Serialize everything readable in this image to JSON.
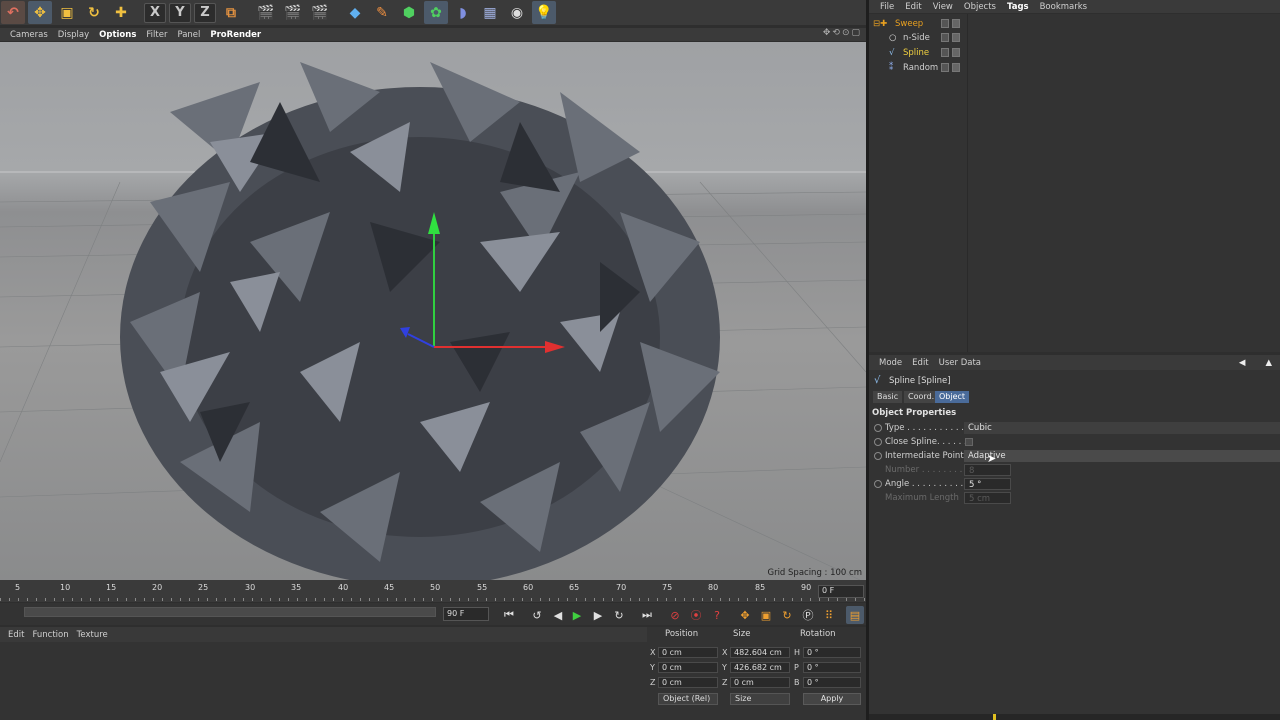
{
  "toolbar": {
    "axis_x": "X",
    "axis_y": "Y",
    "axis_z": "Z"
  },
  "viewport_menu": [
    "Cameras",
    "Display",
    "Options",
    "Filter",
    "Panel",
    "ProRender"
  ],
  "viewport": {
    "grid_spacing": "Grid Spacing : 100 cm"
  },
  "timeline": {
    "ticks": [
      "5",
      "10",
      "15",
      "20",
      "25",
      "30",
      "35",
      "40",
      "45",
      "50",
      "55",
      "60",
      "65",
      "70",
      "75",
      "80",
      "85",
      "90"
    ],
    "current_frame": "0 F",
    "end_frame": "90 F"
  },
  "lower_menu": [
    "Edit",
    "Function",
    "Texture"
  ],
  "coords": {
    "position_header": "Position",
    "size_header": "Size",
    "rotation_header": "Rotation",
    "labels": {
      "x": "X",
      "y": "Y",
      "z": "Z",
      "sx": "X",
      "sy": "Y",
      "sz": "Z",
      "h": "H",
      "p": "P",
      "b": "B"
    },
    "pos_x": "0 cm",
    "pos_y": "0 cm",
    "pos_z": "0 cm",
    "size_x": "482.604 cm",
    "size_y": "426.682 cm",
    "size_z": "0 cm",
    "rot_h": "0 °",
    "rot_p": "0 °",
    "rot_b": "0 °",
    "mode_select": "Object (Rel)",
    "size_select": "Size",
    "apply": "Apply"
  },
  "object_manager": {
    "menu": [
      "File",
      "Edit",
      "View",
      "Objects",
      "Tags",
      "Bookmarks"
    ],
    "objects": [
      {
        "name": "Sweep",
        "color": "#e8a020"
      },
      {
        "name": "n-Side",
        "color": "#d0d0d0"
      },
      {
        "name": "Spline",
        "color": "#f0d040"
      },
      {
        "name": "Random",
        "color": "#d0d0d0"
      }
    ]
  },
  "attributes": {
    "menu": [
      "Mode",
      "Edit",
      "User Data"
    ],
    "title": "Spline [Spline]",
    "tabs": [
      "Basic",
      "Coord.",
      "Object"
    ],
    "active_tab": "Object",
    "section": "Object Properties",
    "type_label": "Type . . . . . . . . . . . . .",
    "type_value": "Cubic",
    "close_label": "Close Spline. . . . . .",
    "intermediate_label": "Intermediate Points",
    "intermediate_value": "Adaptive",
    "number_label": "Number . . . . . . . . .",
    "number_value": "8",
    "angle_label": "Angle . . . . . . . . . .",
    "angle_value": "5 °",
    "maxlen_label": "Maximum Length",
    "maxlen_value": "5 cm"
  }
}
